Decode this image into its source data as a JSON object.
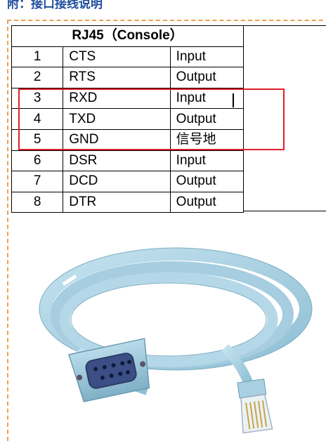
{
  "heading": "附：接口接线说明",
  "table": {
    "title": "RJ45（Console）",
    "rows": [
      {
        "pin": "1",
        "signal": "CTS",
        "direction": "Input"
      },
      {
        "pin": "2",
        "signal": "RTS",
        "direction": "Output"
      },
      {
        "pin": "3",
        "signal": "RXD",
        "direction": "Input"
      },
      {
        "pin": "4",
        "signal": "TXD",
        "direction": "Output"
      },
      {
        "pin": "5",
        "signal": "GND",
        "direction": "信号地"
      },
      {
        "pin": "6",
        "signal": "DSR",
        "direction": "Input"
      },
      {
        "pin": "7",
        "signal": "DCD",
        "direction": "Output"
      },
      {
        "pin": "8",
        "signal": "DTR",
        "direction": "Output"
      }
    ],
    "highlighted_pins": [
      "3",
      "4",
      "5"
    ]
  },
  "colors": {
    "heading": "#1f4e9e",
    "highlight_box": "#e0202a",
    "frame_dashed": "#f0a050",
    "cable": "#a9cfe0"
  },
  "image": {
    "subject": "console-cable-rj45-to-db9-icon"
  }
}
